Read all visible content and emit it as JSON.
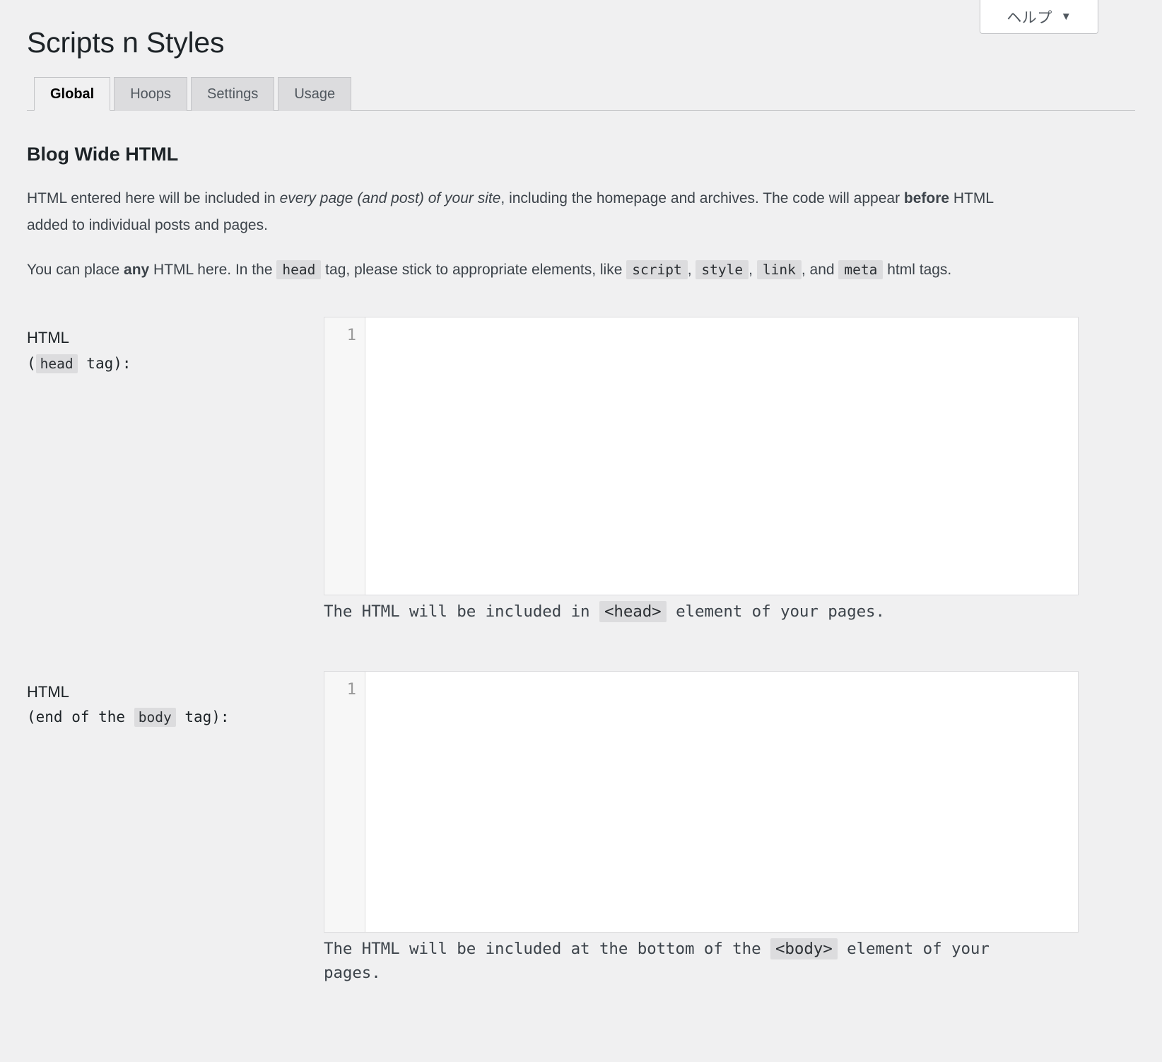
{
  "help": {
    "label": "ヘルプ",
    "caret": "▼"
  },
  "page": {
    "title": "Scripts n Styles"
  },
  "tabs": [
    {
      "label": "Global",
      "active": true
    },
    {
      "label": "Hoops",
      "active": false
    },
    {
      "label": "Settings",
      "active": false
    },
    {
      "label": "Usage",
      "active": false
    }
  ],
  "section": {
    "title": "Blog Wide HTML",
    "intro1": {
      "part1": "HTML entered here will be included in ",
      "em1": "every page (and post) of your site",
      "part2": ", including the homepage and archives. The code will appear ",
      "strong1": "before",
      "part3": " HTML added to individual posts and pages."
    },
    "intro2": {
      "part1": "You can place ",
      "strong1": "any",
      "part2": " HTML here. In the ",
      "code1": "head",
      "part3": " tag, please stick to appropriate elements, like ",
      "code2": "script",
      "part4": ", ",
      "code3": "style",
      "part5": ", ",
      "code4": "link",
      "part6": ", and ",
      "code5": "meta",
      "part7": " html tags."
    }
  },
  "fields": [
    {
      "label_line1": "HTML",
      "label_prefix": "(",
      "label_code": "head",
      "label_suffix": " tag):",
      "line_number": "1",
      "value": "",
      "placeholder": "",
      "desc_part1": "The HTML will be included in ",
      "desc_code": "<head>",
      "desc_part2": " element of your pages."
    },
    {
      "label_line1": "HTML",
      "label_prefix": "(end of the ",
      "label_code": "body",
      "label_suffix": " tag):",
      "line_number": "1",
      "value": "",
      "placeholder": "",
      "desc_part1": "The HTML will be included at the bottom of the ",
      "desc_code": "<body>",
      "desc_part2": " element of your pages."
    }
  ],
  "colors": {
    "page_bg": "#f0f0f1",
    "tab_inactive_bg": "#dcdcde",
    "tab_border": "#c3c4c7",
    "text": "#3c434a",
    "heading": "#1d2327",
    "code_bg": "#dcdcde",
    "editor_bg": "#ffffff",
    "gutter_bg": "#f7f7f7",
    "linenum": "#999999"
  }
}
